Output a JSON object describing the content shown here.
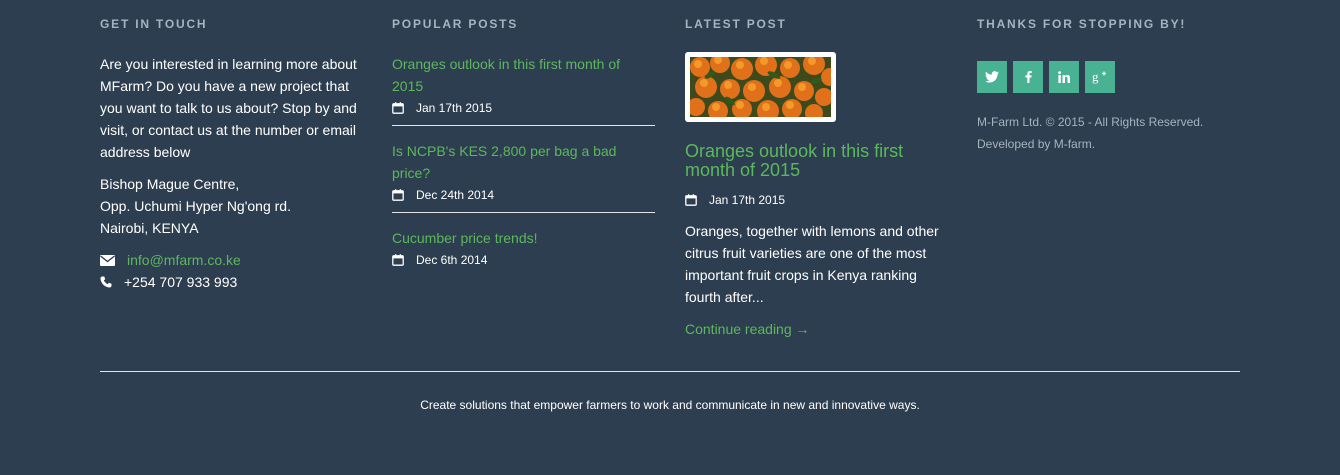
{
  "get_in_touch": {
    "title": "GET IN TOUCH",
    "about": "Are you interested in learning more about MFarm? Do you have a new project that you want to talk to us about? Stop by and visit, or contact us at the number or email address below",
    "address": [
      "Bishop Mague Centre,",
      "Opp. Uchumi Hyper Ng'ong rd.",
      "Nairobi, KENYA"
    ],
    "email": "info@mfarm.co.ke",
    "phone": "+254 707 933 993"
  },
  "popular_posts": {
    "title": "POPULAR POSTS",
    "posts": [
      {
        "title": "Oranges outlook in this first month of 2015",
        "date": "Jan 17th 2015"
      },
      {
        "title": "Is NCPB's KES 2,800 per bag a bad price?",
        "date": "Dec 24th 2014"
      },
      {
        "title": "Cucumber price trends!",
        "date": "Dec 6th 2014"
      }
    ]
  },
  "latest_post": {
    "title": "LATEST POST",
    "post_title": "Oranges outlook in this first month of 2015",
    "date": "Jan 17th 2015",
    "excerpt": "Oranges, together with lemons and other citrus fruit varieties are one of the most important fruit crops in Kenya ranking fourth after...",
    "read_more": "Continue reading →"
  },
  "thanks": {
    "title": "THANKS FOR STOPPING BY!",
    "social": [
      {
        "name": "twitter-icon"
      },
      {
        "name": "facebook-icon"
      },
      {
        "name": "linkedin-icon"
      },
      {
        "name": "google-plus-icon"
      }
    ],
    "copyright": "M-Farm Ltd. © 2015 - All Rights Reserved.",
    "developed_by": "Developed by M-farm."
  },
  "tagline": "Create solutions that empower farmers to work and communicate in new and innovative ways.",
  "colors": {
    "background": "#2d3e50",
    "link": "#5cb85c",
    "social": "#48b293",
    "muted": "#a7b3bf"
  }
}
